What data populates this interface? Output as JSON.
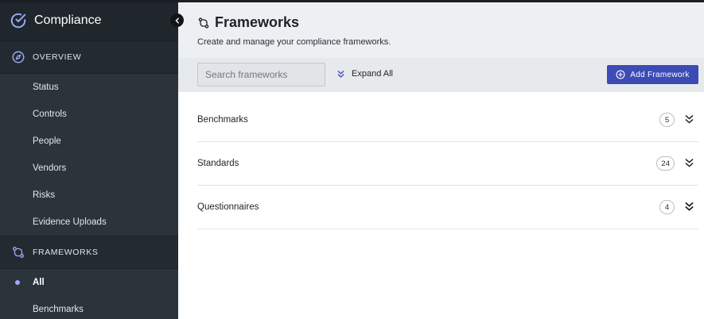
{
  "sidebar": {
    "app_title": "Compliance",
    "overview": {
      "label": "OVERVIEW",
      "items": [
        {
          "label": "Status"
        },
        {
          "label": "Controls"
        },
        {
          "label": "People"
        },
        {
          "label": "Vendors"
        },
        {
          "label": "Risks"
        },
        {
          "label": "Evidence Uploads"
        }
      ]
    },
    "frameworks": {
      "label": "FRAMEWORKS",
      "items": [
        {
          "label": "All",
          "active": true
        },
        {
          "label": "Benchmarks"
        }
      ]
    }
  },
  "header": {
    "title": "Frameworks",
    "subtitle": "Create and manage your compliance frameworks."
  },
  "toolbar": {
    "search_placeholder": "Search frameworks",
    "expand_all_label": "Expand All",
    "add_label": "Add Framework"
  },
  "groups": [
    {
      "name": "Benchmarks",
      "count": "5"
    },
    {
      "name": "Standards",
      "count": "24"
    },
    {
      "name": "Questionnaires",
      "count": "4"
    }
  ],
  "colors": {
    "sidebar_bg": "#2b343b",
    "accent": "#3c4bb5",
    "logo": "#9aa8f5"
  }
}
